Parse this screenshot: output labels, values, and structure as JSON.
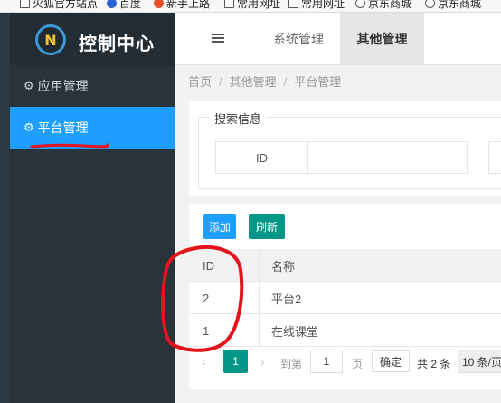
{
  "bookmarks": [
    {
      "label": "火狐官方站点",
      "icon": "folder-icon"
    },
    {
      "label": "百度",
      "icon": "paw-icon"
    },
    {
      "label": "新手上路",
      "icon": "firefox-icon"
    },
    {
      "label": "常用网址",
      "icon": "folder-icon"
    },
    {
      "label": "常用网址",
      "icon": "folder-icon"
    },
    {
      "label": "京东商城",
      "icon": "globe-icon"
    },
    {
      "label": "京东商城",
      "icon": "globe-icon"
    }
  ],
  "sidebar": {
    "title": "控制中心",
    "logo_text": "N",
    "items": [
      {
        "label": "应用管理",
        "icon": "gear-icon",
        "active": false
      },
      {
        "label": "平台管理",
        "icon": "gear-icon",
        "active": true
      }
    ]
  },
  "header": {
    "tabs": [
      {
        "label": "系统管理",
        "active": false
      },
      {
        "label": "其他管理",
        "active": true
      }
    ]
  },
  "breadcrumb": [
    "首页",
    "其他管理",
    "平台管理"
  ],
  "search": {
    "legend": "搜索信息",
    "id_label": "ID",
    "id_value": ""
  },
  "toolbar": {
    "add_label": "添加",
    "refresh_label": "刷新"
  },
  "table": {
    "columns": [
      "ID",
      "名称"
    ],
    "rows": [
      {
        "id": "2",
        "name": "平台2"
      },
      {
        "id": "1",
        "name": "在线课堂"
      }
    ]
  },
  "pagination": {
    "prev": "‹",
    "current_page": "1",
    "next": "›",
    "goto_label": "到第",
    "goto_value": "1",
    "page_unit": "页",
    "confirm_label": "确定",
    "total_text": "共 2 条",
    "page_size": "10 条/页"
  },
  "colors": {
    "accent": "#1e9fff",
    "sidebar": "#28333b",
    "teal": "#009688",
    "annotation": "#e5141c"
  }
}
